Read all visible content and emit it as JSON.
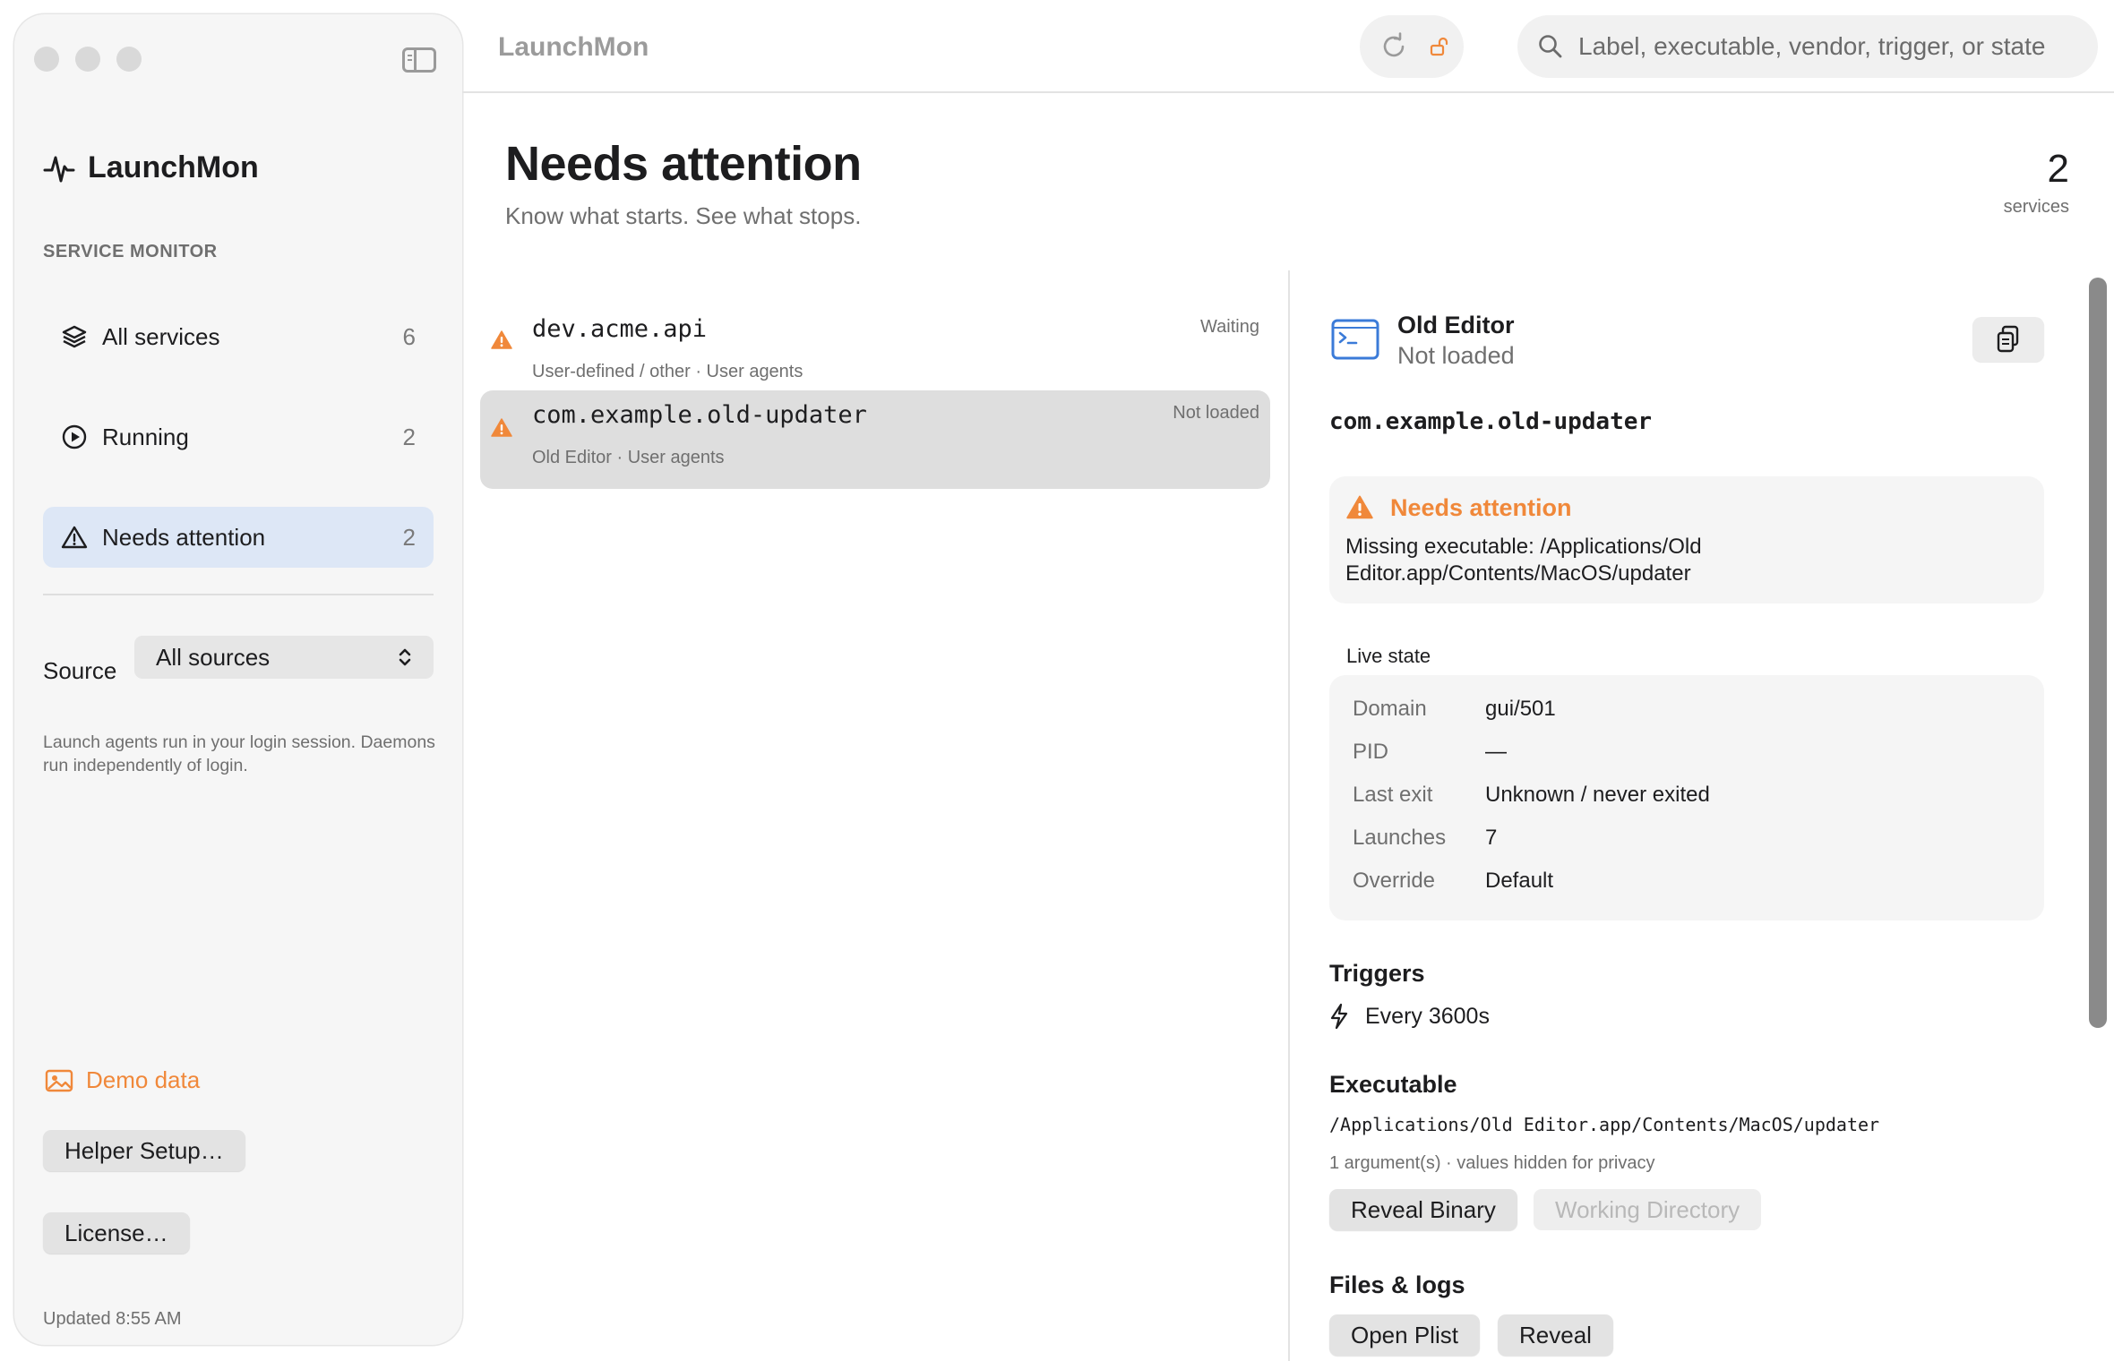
{
  "window": {
    "title": "LaunchMon"
  },
  "sidebar": {
    "brand": "LaunchMon",
    "section_label": "SERVICE MONITOR",
    "items": [
      {
        "label": "All services",
        "count": "6",
        "icon": "layers-icon"
      },
      {
        "label": "Running",
        "count": "2",
        "icon": "play-circle-icon"
      },
      {
        "label": "Needs attention",
        "count": "2",
        "icon": "warning-triangle-icon"
      }
    ],
    "source_label": "Source",
    "source_value": "All sources",
    "help_text": "Launch agents run in your login session. Daemons run independently of login.",
    "demo_label": "Demo data",
    "helper_button": "Helper Setup…",
    "license_button": "License…",
    "updated": "Updated 8:55 AM"
  },
  "toolbar": {
    "search_placeholder": "Label, executable, vendor, trigger, or state"
  },
  "header": {
    "title": "Needs attention",
    "subtitle": "Know what starts. See what stops.",
    "count": "2",
    "count_unit": "services"
  },
  "list": [
    {
      "label": "dev.acme.api",
      "sub": "User-defined / other · User agents",
      "state": "Waiting"
    },
    {
      "label": "com.example.old-updater",
      "sub": "Old Editor · User agents",
      "state": "Not loaded"
    }
  ],
  "detail": {
    "name": "Old Editor",
    "state": "Not loaded",
    "identifier": "com.example.old-updater",
    "attention_title": "Needs attention",
    "attention_text": "Missing executable: /Applications/Old Editor.app/Contents/MacOS/updater",
    "live_state_label": "Live state",
    "live_state": [
      {
        "key": "Domain",
        "value": "gui/501"
      },
      {
        "key": "PID",
        "value": "—"
      },
      {
        "key": "Last exit",
        "value": "Unknown / never exited"
      },
      {
        "key": "Launches",
        "value": "7"
      },
      {
        "key": "Override",
        "value": "Default"
      }
    ],
    "triggers_heading": "Triggers",
    "trigger": "Every 3600s",
    "executable_heading": "Executable",
    "executable_path": "/Applications/Old Editor.app/Contents/MacOS/updater",
    "executable_args": "1 argument(s) · values hidden for privacy",
    "reveal_binary": "Reveal Binary",
    "working_directory": "Working Directory",
    "files_heading": "Files & logs",
    "open_plist": "Open Plist",
    "reveal": "Reveal"
  },
  "colors": {
    "accent_orange": "#f0883a",
    "selection_blue": "#dde7f6",
    "terminal_blue": "#3b7bd8"
  }
}
